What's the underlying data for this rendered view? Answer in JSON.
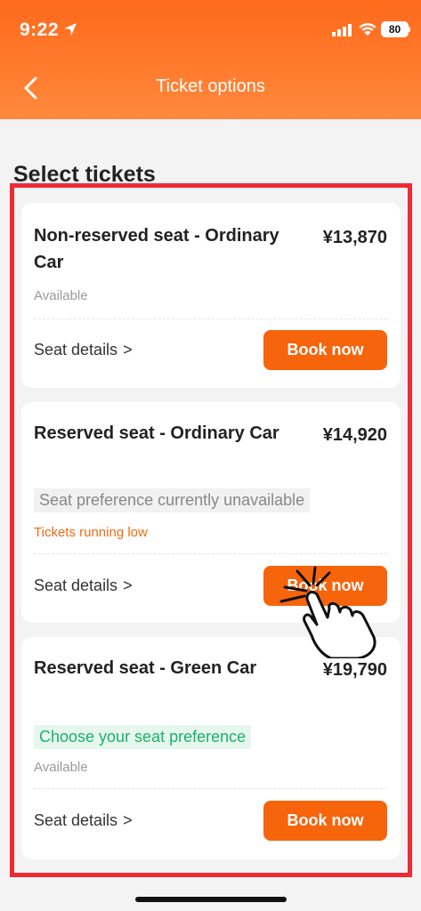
{
  "status_bar": {
    "time": "9:22",
    "battery": "80"
  },
  "header": {
    "title": "Ticket options",
    "back_icon": "chevron-left-icon"
  },
  "section_title": "Select tickets",
  "tickets": [
    {
      "name": "Non-reserved seat - Ordinary Car",
      "price": "¥13,870",
      "status": "Available",
      "details_label": "Seat details",
      "book_label": "Book now"
    },
    {
      "name": "Reserved seat - Ordinary Car",
      "price": "¥14,920",
      "preference": "Seat preference currently unavailable",
      "low_stock": "Tickets running low",
      "details_label": "Seat details",
      "book_label": "Book now"
    },
    {
      "name": "Reserved seat - Green Car",
      "price": "¥19,790",
      "preference": "Choose your seat preference",
      "status": "Available",
      "details_label": "Seat details",
      "book_label": "Book now"
    }
  ],
  "colors": {
    "accent": "#f6640c",
    "header": "#ff7a2d",
    "highlight": "#ee2a35",
    "low_stock": "#f06a10",
    "available_pref": "#1db06a"
  }
}
